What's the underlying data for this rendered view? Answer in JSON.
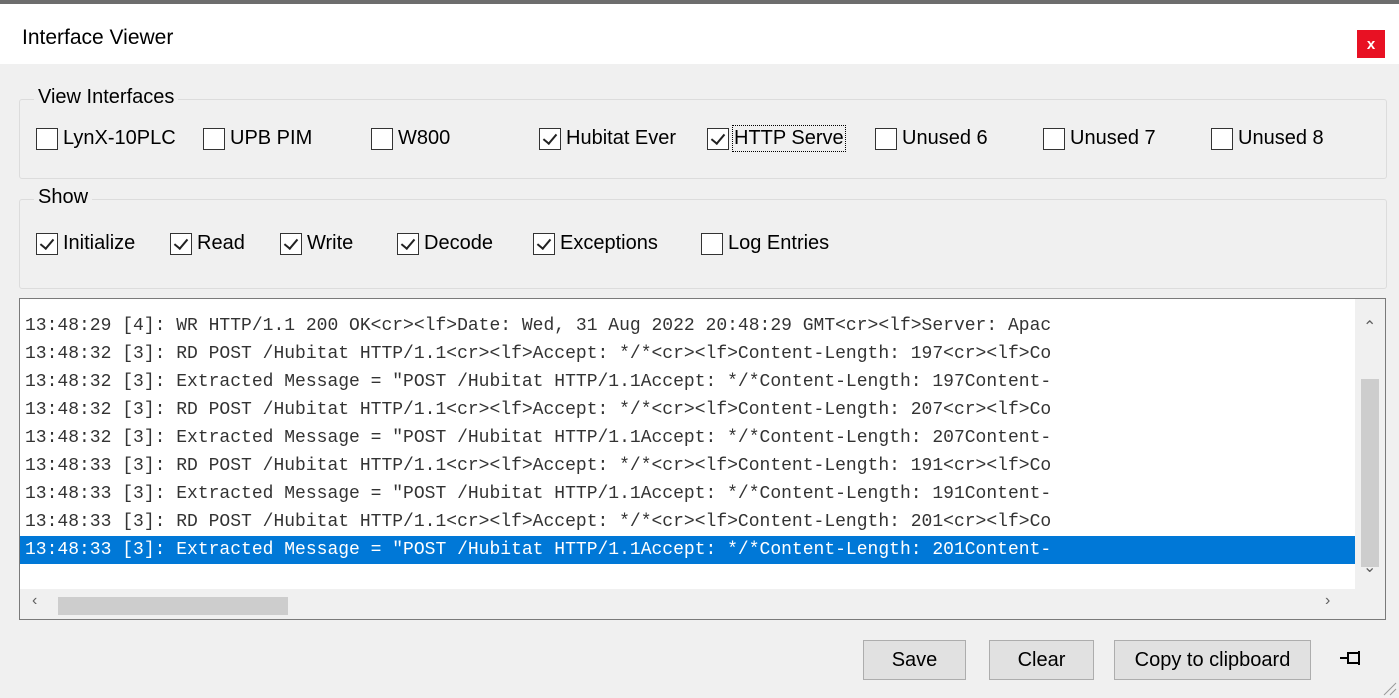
{
  "window": {
    "title": "Interface Viewer",
    "close": "x"
  },
  "view_interfaces": {
    "legend": "View Interfaces",
    "items": [
      {
        "label": "LynX-10PLC",
        "checked": false
      },
      {
        "label": "UPB PIM",
        "checked": false
      },
      {
        "label": "W800",
        "checked": false
      },
      {
        "label": "Hubitat Ever",
        "checked": true
      },
      {
        "label": "HTTP Serve",
        "checked": true
      },
      {
        "label": "Unused 6",
        "checked": false
      },
      {
        "label": "Unused 7",
        "checked": false
      },
      {
        "label": "Unused 8",
        "checked": false
      }
    ]
  },
  "show": {
    "legend": "Show",
    "items": [
      {
        "label": "Initialize",
        "checked": true
      },
      {
        "label": "Read",
        "checked": true
      },
      {
        "label": "Write",
        "checked": true
      },
      {
        "label": "Decode",
        "checked": true
      },
      {
        "label": "Exceptions",
        "checked": true
      },
      {
        "label": "Log Entries",
        "checked": false
      }
    ]
  },
  "log": {
    "lines": [
      "13:48:29 [4]: WR HTTP/1.1 200 OK<cr><lf>Date: Wed, 31 Aug 2022 20:48:29 GMT<cr><lf>Server: Apac",
      "13:48:32 [3]: RD POST /Hubitat HTTP/1.1<cr><lf>Accept: */*<cr><lf>Content-Length: 197<cr><lf>Co",
      "13:48:32 [3]: Extracted Message = \"POST /Hubitat HTTP/1.1Accept: */*Content-Length: 197Content-",
      "13:48:32 [3]: RD POST /Hubitat HTTP/1.1<cr><lf>Accept: */*<cr><lf>Content-Length: 207<cr><lf>Co",
      "13:48:32 [3]: Extracted Message = \"POST /Hubitat HTTP/1.1Accept: */*Content-Length: 207Content-",
      "13:48:33 [3]: RD POST /Hubitat HTTP/1.1<cr><lf>Accept: */*<cr><lf>Content-Length: 191<cr><lf>Co",
      "13:48:33 [3]: Extracted Message = \"POST /Hubitat HTTP/1.1Accept: */*Content-Length: 191Content-",
      "13:48:33 [3]: RD POST /Hubitat HTTP/1.1<cr><lf>Accept: */*<cr><lf>Content-Length: 201<cr><lf>Co",
      "13:48:33 [3]: Extracted Message = \"POST /Hubitat HTTP/1.1Accept: */*Content-Length: 201Content-"
    ],
    "selected_index": 8
  },
  "buttons": {
    "save": "Save",
    "clear": "Clear",
    "copy": "Copy to clipboard"
  }
}
